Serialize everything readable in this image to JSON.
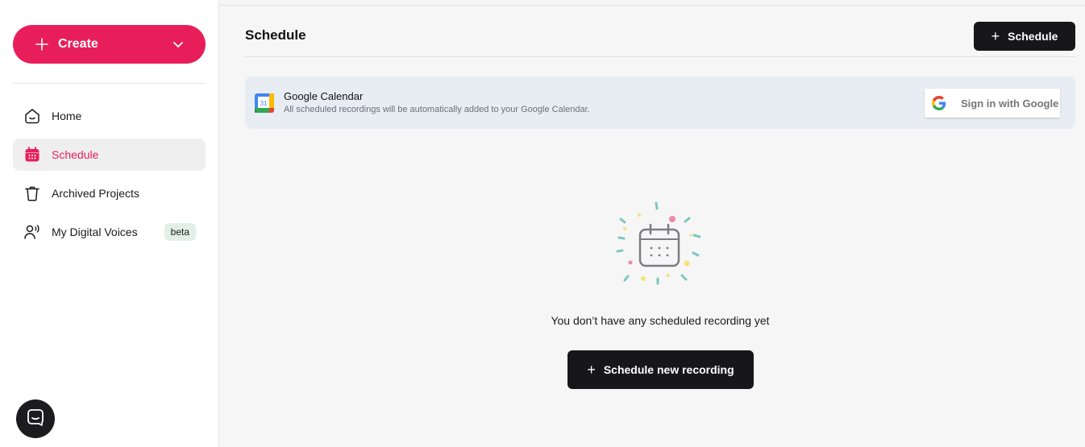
{
  "sidebar": {
    "create_label": "Create",
    "items": [
      {
        "label": "Home",
        "icon": "home-icon"
      },
      {
        "label": "Schedule",
        "icon": "calendar-icon",
        "active": true
      },
      {
        "label": "Archived Projects",
        "icon": "trash-icon"
      },
      {
        "label": "My Digital Voices",
        "icon": "digital-voice-icon",
        "badge": "beta"
      }
    ]
  },
  "header": {
    "title": "Schedule",
    "schedule_button": "Schedule"
  },
  "google_calendar": {
    "title": "Google Calendar",
    "description": "All scheduled recordings will be automatically added to your Google Calendar.",
    "icon_day": "31",
    "signin_label": "Sign in with Google"
  },
  "empty_state": {
    "message": "You don’t have any scheduled recording yet",
    "button_label": "Schedule new recording"
  },
  "colors": {
    "accent": "#e81e5a",
    "dark_button": "#17171a",
    "banner_bg": "#e8edf4",
    "beta_bg": "#e2efe9"
  }
}
